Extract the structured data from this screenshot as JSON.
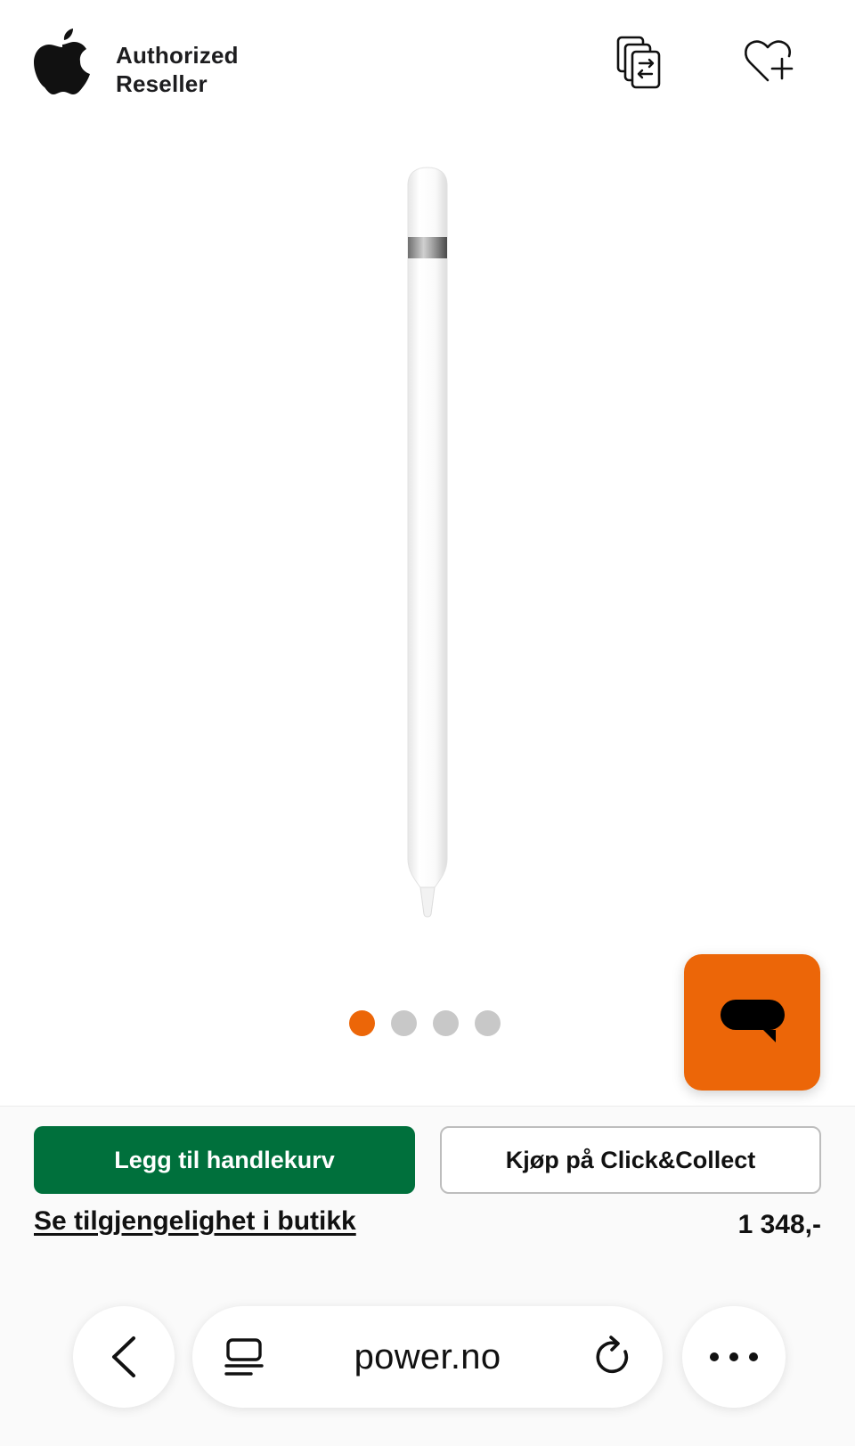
{
  "header": {
    "reseller_line1": "Authorized",
    "reseller_line2": "Reseller",
    "logo_icon": "apple-logo",
    "compare_icon": "compare-icon",
    "wishlist_icon": "heart-plus-icon"
  },
  "carousel": {
    "total": 4,
    "active_index": 0
  },
  "chat": {
    "icon": "chat-bubble-icon",
    "color": "#ec6608"
  },
  "actions": {
    "add_to_cart": "Legg til handlekurv",
    "click_collect": "Kjøp på Click&Collect",
    "store_availability": "Se tilgjengelighet i butikk",
    "price": "1 348,-"
  },
  "browser": {
    "url": "power.no",
    "back_icon": "chevron-left-icon",
    "reader_icon": "reader-icon",
    "reload_icon": "reload-icon",
    "more_icon": "more-icon"
  },
  "colors": {
    "brand_orange": "#ec6608",
    "cart_green": "#00703c"
  }
}
